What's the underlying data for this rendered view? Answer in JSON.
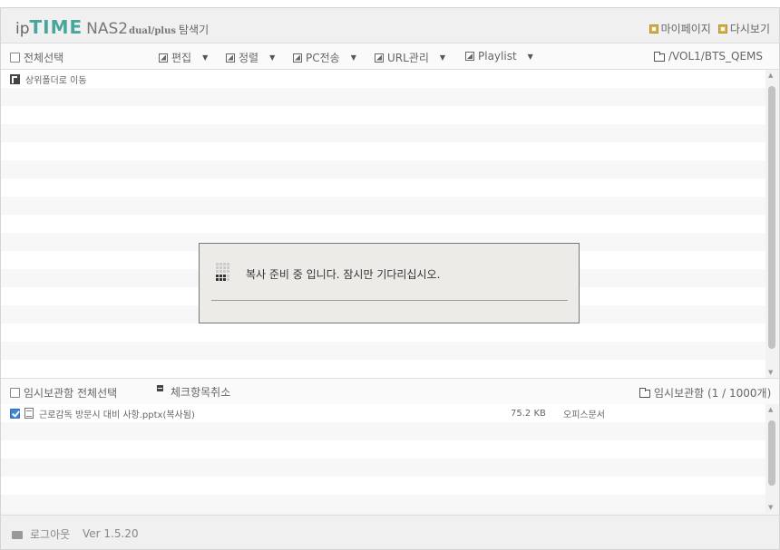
{
  "header": {
    "logo_ip": "ip",
    "logo_time": "TIME",
    "logo_nas": "NAS2",
    "logo_dual": "dual/plus",
    "logo_explorer": "탐색기",
    "mypage_label": "마이페이지",
    "refresh_label": "다시보기"
  },
  "toolbar": {
    "select_all": "전체선택",
    "edit": "편집",
    "sort": "정렬",
    "pc_transfer": "PC전송",
    "url_manage": "URL관리",
    "playlist": "Playlist",
    "current_path": "/VOL1/BTS_QEMS"
  },
  "file_list": {
    "up_folder": "상위폴더로 이동"
  },
  "dialog": {
    "message": "복사 준비 중 입니다. 잠시만 기다리십시오."
  },
  "temp_bar": {
    "select_all": "임시보관함 전체선택",
    "uncheck": "체크항목취소",
    "title": "임시보관함 (1 / 1000개)"
  },
  "temp_items": [
    {
      "name": "근로감독 방문시 대비 사항.pptx(복사됨)",
      "size": "75.2 KB",
      "type": "오피스문서",
      "checked": true
    }
  ],
  "footer": {
    "logout": "로그아웃",
    "version": "Ver 1.5.20"
  }
}
